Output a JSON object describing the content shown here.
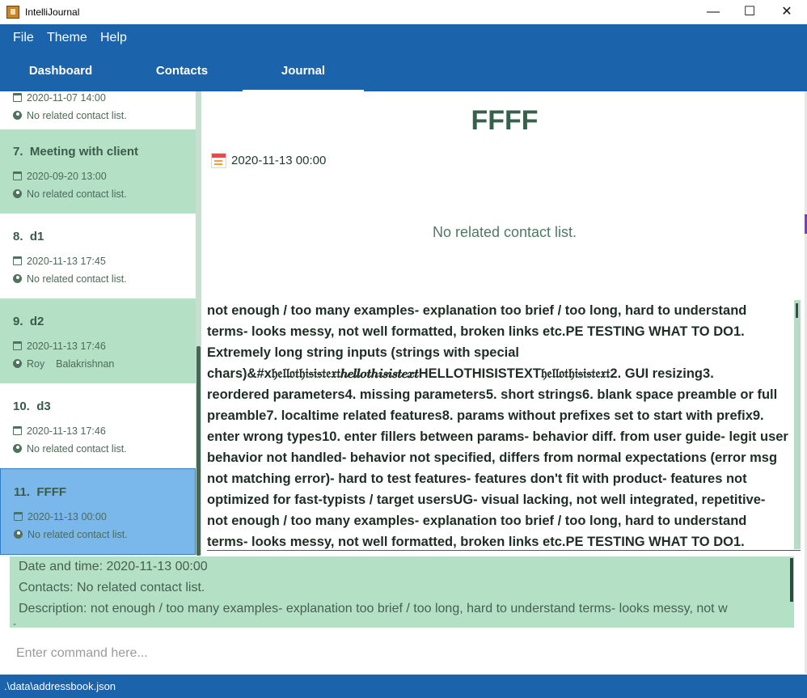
{
  "window": {
    "title": "IntelliJournal",
    "controls": [
      "—",
      "☐",
      "✕"
    ]
  },
  "menu": {
    "items": [
      "File",
      "Theme",
      "Help"
    ]
  },
  "tabs": [
    {
      "label": "Dashboard",
      "active": false
    },
    {
      "label": "Contacts",
      "active": false
    },
    {
      "label": "Journal",
      "active": true
    }
  ],
  "journal_list": {
    "entries": [
      {
        "number": "",
        "title": "",
        "datetime": "2020-11-07 14:00",
        "contacts": "No related contact list.",
        "highlight": false,
        "selected": false
      },
      {
        "number": "7.",
        "title": "Meeting with client",
        "datetime": "2020-09-20 13:00",
        "contacts": "No related contact list.",
        "highlight": true,
        "selected": false
      },
      {
        "number": "8.",
        "title": "d1",
        "datetime": "2020-11-13 17:45",
        "contacts": "No related contact list.",
        "highlight": false,
        "selected": false
      },
      {
        "number": "9.",
        "title": "d2",
        "datetime": "2020-11-13 17:46",
        "contacts": "Roy    Balakrishnan",
        "highlight": true,
        "selected": false
      },
      {
        "number": "10.",
        "title": "d3",
        "datetime": "2020-11-13 17:46",
        "contacts": "No related contact list.",
        "highlight": false,
        "selected": false
      },
      {
        "number": "11.",
        "title": "FFFF",
        "datetime": "2020-11-13 00:00",
        "contacts": "No related contact list.",
        "highlight": false,
        "selected": true
      }
    ]
  },
  "detail": {
    "title": "FFFF",
    "datetime": "2020-11-13 00:00",
    "contacts": "No related contact list.",
    "description_lines": [
      "not enough / too many examples- explanation too brief / too long, hard to understand",
      "terms- looks messy, not well formatted, broken links etc.PE TESTING WHAT TO DO1.",
      "Extremely long string inputs (strings with special",
      "chars)&#x𝔥𝔢𝔩𝔩𝔬𝔱𝔥𝔦𝔰𝔦𝔰𝔱𝔢𝔵𝔱𝒉𝒆𝒍𝒍𝒐𝒕𝒉𝒊𝒔𝒊𝒔𝒕𝒆𝒙𝒕HELLOTHISISTEXT𝔥𝔢𝔩𝔩𝔬𝔱𝔥𝔦𝔰𝔦𝔰𝔱𝔢𝔵𝔱2. GUI resizing3.",
      "reordered parameters4. missing parameters5. short strings6. blank space preamble or full",
      "preamble7. localtime related features8. params without prefixes set to start with prefix9.",
      "enter wrong types10. enter fillers between params- behavior diff. from user guide- legit user",
      "behavior not handled- behavior not specified, differs from normal expectations (error msg",
      "not matching error)- hard to test features- features don't fit with product- features not",
      "optimized for fast-typists / target usersUG- visual lacking, not well integrated, repetitive-",
      "not enough / too many examples- explanation too brief / too long, hard to understand",
      "terms- looks messy, not well formatted, broken links etc.PE TESTING WHAT TO DO1."
    ]
  },
  "result": {
    "lines": [
      "Date and time: 2020-11-13 00:00",
      "Contacts: No related contact list.",
      "Description: not enough / too many examples- explanation too brief / too long, hard to understand terms- looks messy, not w",
      "-"
    ]
  },
  "command": {
    "placeholder": "Enter command here..."
  },
  "status": {
    "path": ".\\data\\addressbook.json"
  },
  "colors": {
    "primary": "#1b63ab",
    "card_highlight": "#b4e0c6",
    "card_selected": "#7ab8eb",
    "heading": "#37614d"
  }
}
